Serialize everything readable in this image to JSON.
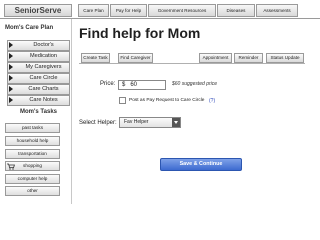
{
  "nav": {
    "brand": "SeniorServe",
    "tabs": [
      "Care Plan",
      "Pay for Help",
      "Government Resources",
      "Diseases",
      "Assessments"
    ]
  },
  "sidebar": {
    "heading": "Mom's Care Plan",
    "items": [
      "Doctor's",
      "Medication",
      "My Caregivers",
      "Care Circle",
      "Care Charts",
      "Care Notes"
    ],
    "tasks_heading": "Mom's Tasks",
    "tasks": [
      "past tasks",
      "household help",
      "transportation",
      "shopping",
      "computer help",
      "other"
    ]
  },
  "main": {
    "title": "Find help for Mom",
    "subtabs_left": [
      "Create Task",
      "Find Caregiver"
    ],
    "subtabs_right": [
      "Appointment",
      "Reminder",
      "Status Update"
    ],
    "price_label": "Price:",
    "price_currency": "$",
    "price_value": "60",
    "price_note": "$60 suggested price",
    "post_label": "Post as Pay Request to Care Circle",
    "help_link": "(?)",
    "helper_label": "Select Helper:",
    "helper_value": "Fav Helper",
    "save_button": "Save & Continue"
  },
  "colors": {
    "accent": "#3d6bd0",
    "link": "#2a45b8"
  },
  "icons": {
    "sidebar_item": "triangle-right-icon",
    "shopping": "cart-icon",
    "select": "chevron-down-icon"
  }
}
